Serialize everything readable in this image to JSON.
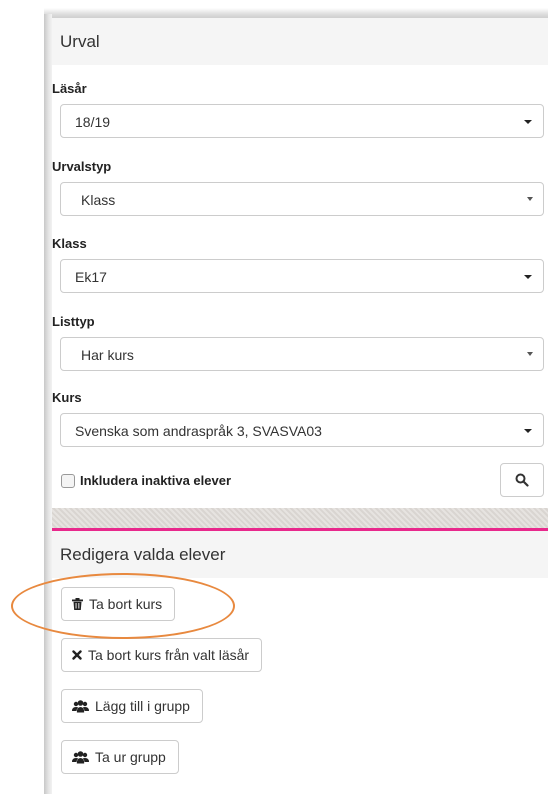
{
  "panel": {
    "title": "Urval"
  },
  "fields": {
    "lasar": {
      "label": "Läsår",
      "value": "18/19"
    },
    "urvalstyp": {
      "label": "Urvalstyp",
      "value": "Klass"
    },
    "klass": {
      "label": "Klass",
      "value": "Ek17"
    },
    "listtyp": {
      "label": "Listtyp",
      "value": "Har kurs"
    },
    "kurs": {
      "label": "Kurs",
      "value": "Svenska som andraspråk 3, SVASVA03"
    }
  },
  "include_inactive": {
    "label": "Inkludera inaktiva elever",
    "checked": false
  },
  "edit_section": {
    "title": "Redigera valda elever",
    "buttons": {
      "remove_course": {
        "label": "Ta bort kurs",
        "icon": "trash-icon"
      },
      "remove_course_year": {
        "label": "Ta bort kurs från valt läsår",
        "icon": "close-icon"
      },
      "add_to_group": {
        "label": "Lägg till i grupp",
        "icon": "users-icon"
      },
      "remove_from_group": {
        "label": "Ta ur grupp",
        "icon": "users-icon"
      }
    }
  },
  "colors": {
    "accent_pink": "#e8288c",
    "highlight_orange": "#e8893f"
  }
}
